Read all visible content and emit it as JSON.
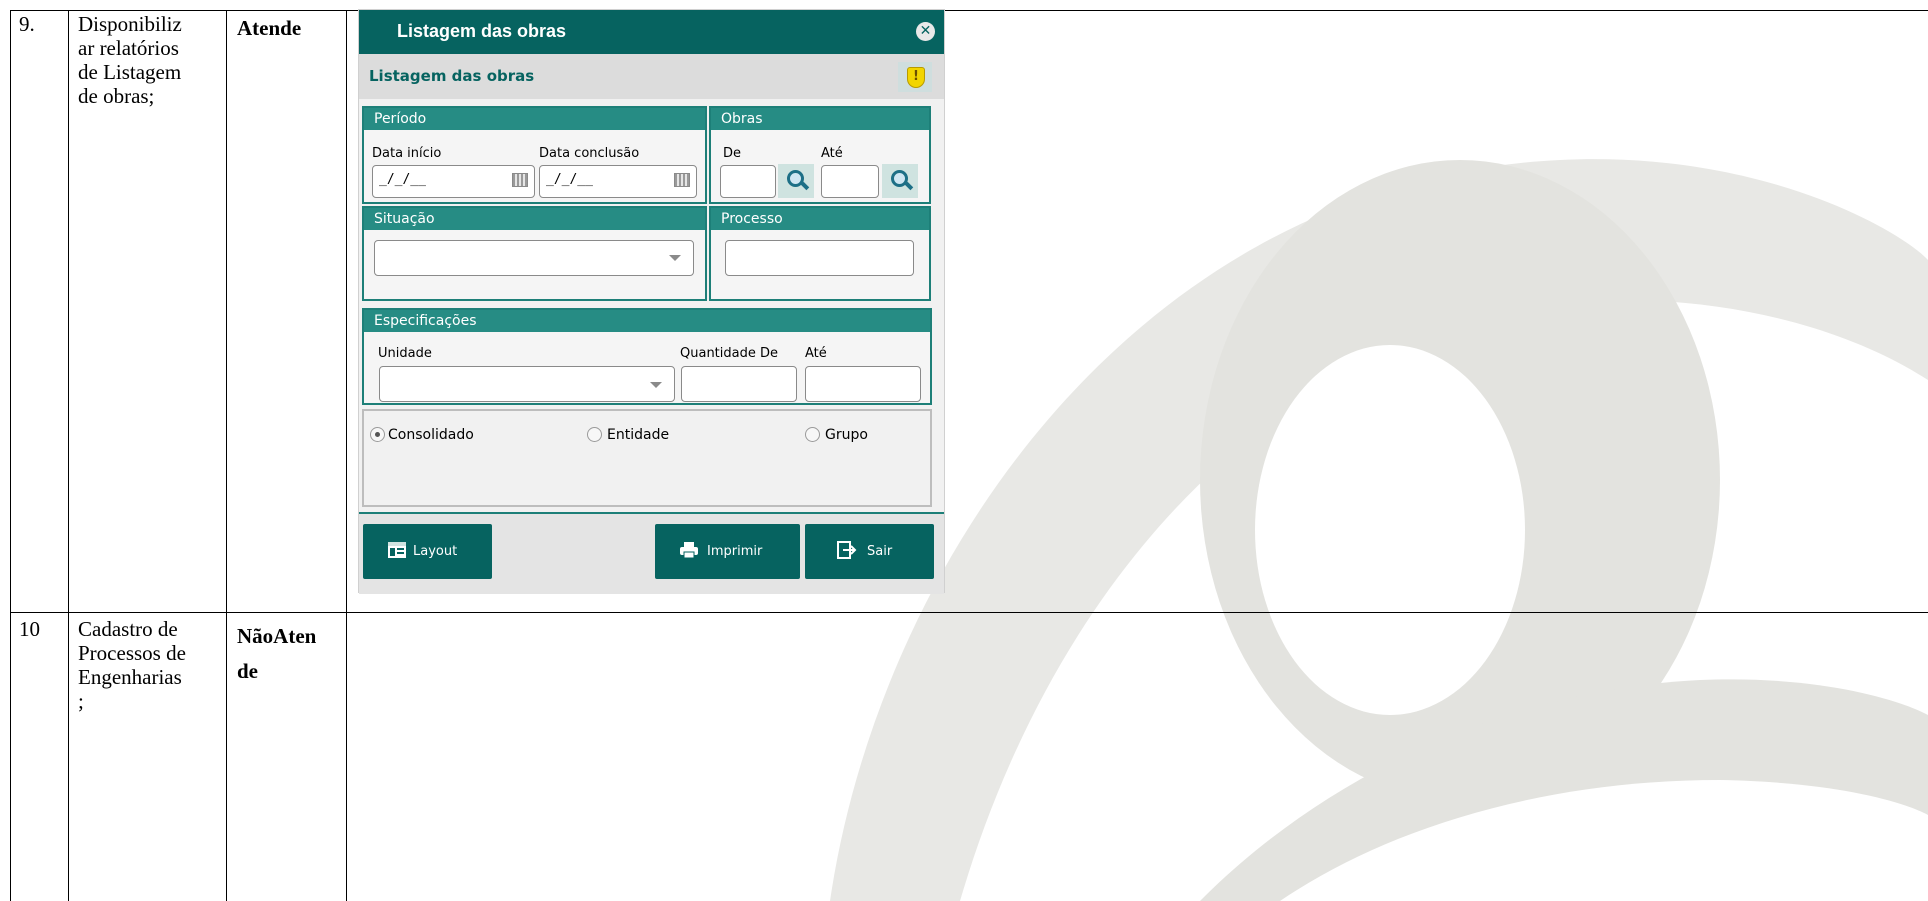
{
  "table": {
    "rows": [
      {
        "num": "9.",
        "desc_lines": [
          "Disponibiliz",
          "ar relatórios",
          "de Listagem",
          "de obras;"
        ],
        "status": "Atende"
      },
      {
        "num": "10",
        "desc_lines": [
          "Cadastro de",
          "Processos de",
          "Engenharias",
          ";"
        ],
        "status_lines": [
          "NãoAten",
          "de"
        ]
      }
    ]
  },
  "dialog": {
    "title": "Listagem das obras",
    "subtitle": "Listagem das obras",
    "periodo": {
      "title": "Período",
      "data_inicio_label": "Data início",
      "data_inicio_value": "_/_/__",
      "data_conclusao_label": "Data conclusão",
      "data_conclusao_value": "_/_/__"
    },
    "obras": {
      "title": "Obras",
      "de_label": "De",
      "ate_label": "Até",
      "de_value": "",
      "ate_value": ""
    },
    "situacao": {
      "title": "Situação",
      "selected": ""
    },
    "processo": {
      "title": "Processo",
      "value": ""
    },
    "especificacoes": {
      "title": "Especificações",
      "unidade_label": "Unidade",
      "quantidade_de_label": "Quantidade De",
      "ate_label": "Até",
      "unidade_selected": "",
      "quantidade_de_value": "",
      "ate_value": ""
    },
    "tipo": {
      "options": [
        "Consolidado",
        "Entidade",
        "Grupo"
      ],
      "selected": "Consolidado"
    },
    "buttons": {
      "layout": "Layout",
      "imprimir": "Imprimir",
      "sair": "Sair"
    },
    "colors": {
      "title_bar": "#066360",
      "group_header": "#268c84",
      "accent_text": "#066360"
    }
  }
}
